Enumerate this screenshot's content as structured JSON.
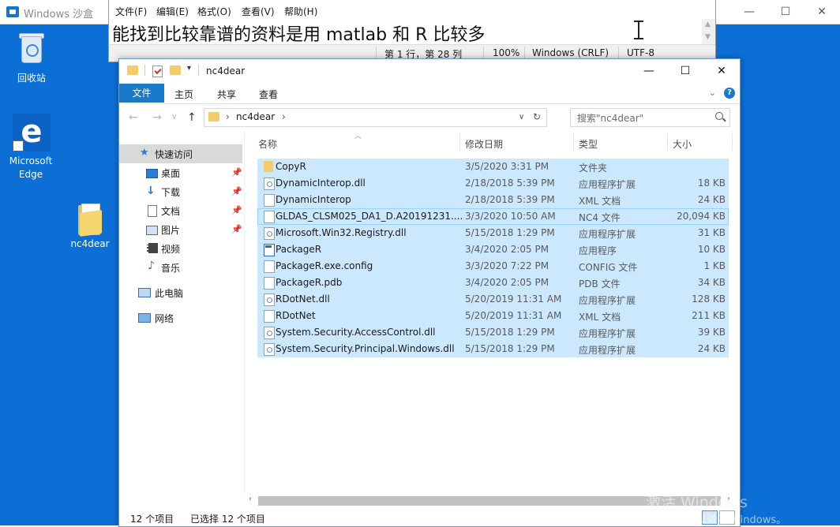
{
  "sandbox": {
    "title": "Windows 沙盒",
    "controls": {
      "minimize": "—",
      "maximize": "☐",
      "close": "✕"
    }
  },
  "desktop": {
    "icons": [
      {
        "label": "回收站"
      },
      {
        "label": "Microsoft Edge"
      },
      {
        "label": "nc4dear"
      }
    ]
  },
  "notepad": {
    "menu": [
      "文件(F)",
      "编辑(E)",
      "格式(O)",
      "查看(V)",
      "帮助(H)"
    ],
    "content": "能找到比较靠谱的资料是用 matlab 和 R 比较多",
    "status": {
      "position": "第 1 行，第 28 列",
      "zoom": "100%",
      "line_ending": "Windows (CRLF)",
      "encoding": "UTF-8"
    }
  },
  "explorer": {
    "title": "nc4dear",
    "controls": {
      "minimize": "—",
      "maximize": "☐",
      "close": "✕"
    },
    "ribbon_tabs": [
      "文件",
      "主页",
      "共享",
      "查看"
    ],
    "address": {
      "crumb": "nc4dear"
    },
    "search_placeholder": "搜索\"nc4dear\"",
    "nav": [
      {
        "label": "快速访问",
        "pinned": false
      },
      {
        "label": "桌面",
        "pinned": true
      },
      {
        "label": "下载",
        "pinned": true
      },
      {
        "label": "文档",
        "pinned": true
      },
      {
        "label": "图片",
        "pinned": true
      },
      {
        "label": "视频",
        "pinned": false
      },
      {
        "label": "音乐",
        "pinned": false
      },
      {
        "label": "此电脑",
        "pinned": false
      },
      {
        "label": "网络",
        "pinned": false
      }
    ],
    "columns": [
      "名称",
      "修改日期",
      "类型",
      "大小"
    ],
    "files": [
      {
        "name": "CopyR",
        "date": "3/5/2020 3:31 PM",
        "type": "文件夹",
        "size": "",
        "icon": "folder"
      },
      {
        "name": "DynamicInterop.dll",
        "date": "2/18/2018 5:39 PM",
        "type": "应用程序扩展",
        "size": "18 KB",
        "icon": "dll"
      },
      {
        "name": "DynamicInterop",
        "date": "2/18/2018 5:39 PM",
        "type": "XML 文档",
        "size": "24 KB",
        "icon": "doc"
      },
      {
        "name": "GLDAS_CLSM025_DA1_D.A20191231....",
        "date": "3/3/2020 10:50 AM",
        "type": "NC4 文件",
        "size": "20,094 KB",
        "icon": "doc"
      },
      {
        "name": "Microsoft.Win32.Registry.dll",
        "date": "5/15/2018 1:29 PM",
        "type": "应用程序扩展",
        "size": "31 KB",
        "icon": "dll"
      },
      {
        "name": "PackageR",
        "date": "3/4/2020 2:05 PM",
        "type": "应用程序",
        "size": "10 KB",
        "icon": "exe"
      },
      {
        "name": "PackageR.exe.config",
        "date": "3/3/2020 7:22 PM",
        "type": "CONFIG 文件",
        "size": "1 KB",
        "icon": "doc"
      },
      {
        "name": "PackageR.pdb",
        "date": "3/4/2020 2:05 PM",
        "type": "PDB 文件",
        "size": "34 KB",
        "icon": "doc"
      },
      {
        "name": "RDotNet.dll",
        "date": "5/20/2019 11:31 AM",
        "type": "应用程序扩展",
        "size": "128 KB",
        "icon": "dll"
      },
      {
        "name": "RDotNet",
        "date": "5/20/2019 11:31 AM",
        "type": "XML 文档",
        "size": "211 KB",
        "icon": "doc"
      },
      {
        "name": "System.Security.AccessControl.dll",
        "date": "5/15/2018 1:29 PM",
        "type": "应用程序扩展",
        "size": "39 KB",
        "icon": "dll"
      },
      {
        "name": "System.Security.Principal.Windows.dll",
        "date": "5/15/2018 1:29 PM",
        "type": "应用程序扩展",
        "size": "24 KB",
        "icon": "dll"
      }
    ],
    "status": {
      "count": "12 个项目",
      "selected": "已选择 12 个项目"
    }
  },
  "watermark": {
    "line1": "激活 Windows",
    "line2": "转到\"设置\"以激活 Windows。"
  },
  "colors": {
    "desktop": "#0c6fd6",
    "selection": "#cce8ff",
    "accent": "#1979ca"
  }
}
